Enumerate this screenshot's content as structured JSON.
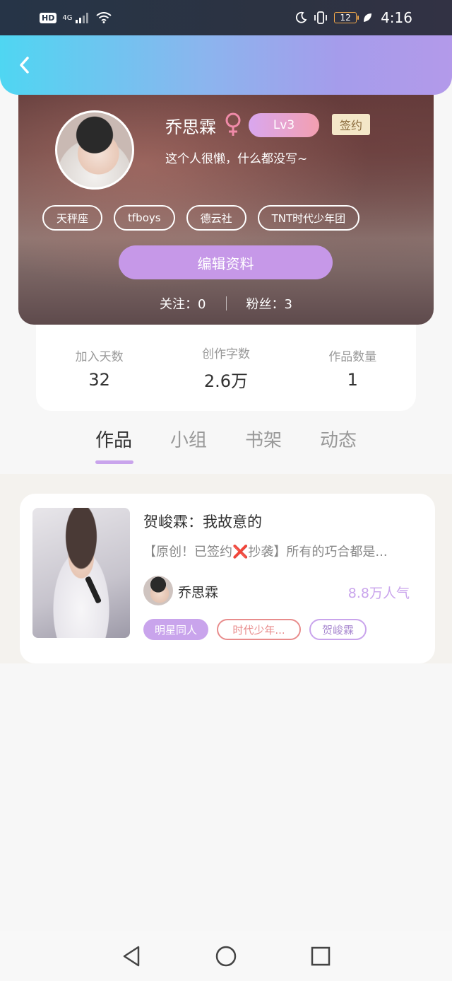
{
  "status_bar": {
    "hd": "HD",
    "network": "4G",
    "battery": "12",
    "time": "4:16"
  },
  "profile": {
    "username": "乔思霖",
    "level": "Lv3",
    "signed": "签约",
    "bio": "这个人很懒，什么都没写~",
    "tags": [
      "天秤座",
      "tfboys",
      "德云社",
      "TNT时代少年团"
    ],
    "edit_button": "编辑资料",
    "following_label": "关注：0",
    "followers_label": "粉丝：3"
  },
  "stats": [
    {
      "label": "加入天数",
      "value": "32"
    },
    {
      "label": "创作字数",
      "value": "2.6万"
    },
    {
      "label": "作品数量",
      "value": "1"
    }
  ],
  "tabs": [
    {
      "label": "作品",
      "active": true
    },
    {
      "label": "小组",
      "active": false
    },
    {
      "label": "书架",
      "active": false
    },
    {
      "label": "动态",
      "active": false
    }
  ],
  "work": {
    "title": "贺峻霖：我故意的",
    "description": "【原创！已签约❌抄袭】所有的巧合都是...",
    "author": "乔思霖",
    "popularity": "8.8万人气",
    "tags": [
      "明星同人",
      "时代少年...",
      "贺峻霖"
    ]
  },
  "colors": {
    "accent_purple": "#c9a4ec",
    "nav_gradient_start": "#4fd6f2",
    "nav_gradient_end": "#b39aea",
    "red_tag": "#e88c8c"
  }
}
